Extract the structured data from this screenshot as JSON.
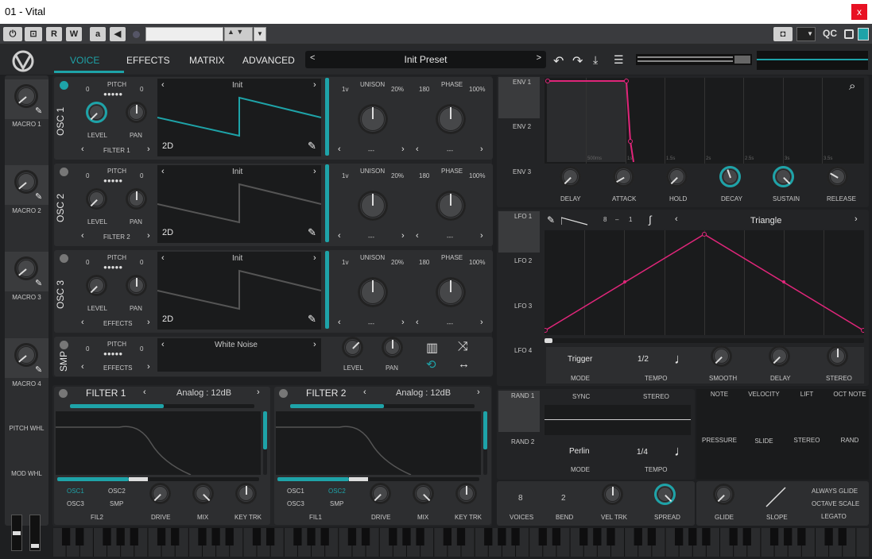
{
  "window": {
    "title": "01 - Vital",
    "close": "x"
  },
  "host": {
    "buttons": [
      "⏻",
      "⊡",
      "R",
      "W",
      "a",
      "◀"
    ],
    "qc": "QC",
    "colors": {
      "accent": "#1ea3a8",
      "pink": "#e0267a"
    }
  },
  "tabs": [
    "VOICE",
    "EFFECTS",
    "MATRIX",
    "ADVANCED"
  ],
  "preset": {
    "name": "Init Preset",
    "prev": "<",
    "next": ">"
  },
  "macros": [
    "MACRO 1",
    "MACRO 2",
    "MACRO 3",
    "MACRO 4"
  ],
  "wheels": {
    "pitch": "PITCH WHL",
    "mod": "MOD WHL"
  },
  "oscs": [
    {
      "name": "OSC 1",
      "pitch_left": "0",
      "pitch_label": "PITCH",
      "pitch_right": "0",
      "level": "LEVEL",
      "pan": "PAN",
      "dest": "FILTER 1",
      "wave": "Init",
      "mode": "2D",
      "unison_left": "1v",
      "unison": "UNISON",
      "unison_pct": "20%",
      "phase_left": "180",
      "phase": "PHASE",
      "phase_pct": "100%",
      "sel1": "---",
      "sel2": "---"
    },
    {
      "name": "OSC 2",
      "pitch_left": "0",
      "pitch_label": "PITCH",
      "pitch_right": "0",
      "level": "LEVEL",
      "pan": "PAN",
      "dest": "FILTER 2",
      "wave": "Init",
      "mode": "2D",
      "unison_left": "1v",
      "unison": "UNISON",
      "unison_pct": "20%",
      "phase_left": "180",
      "phase": "PHASE",
      "phase_pct": "100%",
      "sel1": "---",
      "sel2": "---"
    },
    {
      "name": "OSC 3",
      "pitch_left": "0",
      "pitch_label": "PITCH",
      "pitch_right": "0",
      "level": "LEVEL",
      "pan": "PAN",
      "dest": "EFFECTS",
      "wave": "Init",
      "mode": "2D",
      "unison_left": "1v",
      "unison": "UNISON",
      "unison_pct": "20%",
      "phase_left": "180",
      "phase": "PHASE",
      "phase_pct": "100%",
      "sel1": "---",
      "sel2": "---"
    }
  ],
  "smp": {
    "name": "SMP",
    "pitch_left": "0",
    "pitch_label": "PITCH",
    "pitch_right": "0",
    "dest": "EFFECTS",
    "sample": "White Noise",
    "level": "LEVEL",
    "pan": "PAN"
  },
  "filters": [
    {
      "name": "FILTER 1",
      "type": "Analog : 12dB",
      "src": [
        "OSC1",
        "OSC2",
        "OSC3",
        "SMP"
      ],
      "route": "FIL2",
      "drive": "DRIVE",
      "mix": "MIX",
      "keytrk": "KEY TRK"
    },
    {
      "name": "FILTER 2",
      "type": "Analog : 12dB",
      "src": [
        "OSC1",
        "OSC2",
        "OSC3",
        "SMP"
      ],
      "route": "FIL1",
      "drive": "DRIVE",
      "mix": "MIX",
      "keytrk": "KEY TRK"
    }
  ],
  "env": {
    "tabs": [
      "ENV 1",
      "ENV 2",
      "ENV 3"
    ],
    "times": [
      "500ms",
      "1s",
      "1.5s",
      "2s",
      "2.5s",
      "3s",
      "3.5s"
    ],
    "knobs": [
      "DELAY",
      "ATTACK",
      "HOLD",
      "DECAY",
      "SUSTAIN",
      "RELEASE"
    ]
  },
  "lfo": {
    "tabs": [
      "LFO 1",
      "LFO 2",
      "LFO 3",
      "LFO 4"
    ],
    "frac_top": "8",
    "frac_dash": "–",
    "frac_bot": "1",
    "shape": "Triangle",
    "mode_value": "Trigger",
    "mode_label": "MODE",
    "tempo_value": "1/2",
    "tempo_label": "TEMPO",
    "knobs": [
      "SMOOTH",
      "DELAY",
      "STEREO"
    ]
  },
  "rand": {
    "tabs": [
      "RAND 1",
      "RAND 2"
    ],
    "sync": "SYNC",
    "stereo": "STEREO",
    "mode_value": "Perlin",
    "mode_label": "MODE",
    "tempo_value": "1/4",
    "tempo_label": "TEMPO"
  },
  "sources": [
    "NOTE",
    "VELOCITY",
    "LIFT",
    "OCT NOTE",
    "PRESSURE",
    "SLIDE",
    "STEREO",
    "RAND"
  ],
  "voice": {
    "voices_value": "8",
    "voices": "VOICES",
    "bend_value": "2",
    "bend": "BEND",
    "veltrk": "VEL TRK",
    "spread": "SPREAD"
  },
  "glide": {
    "glide": "GLIDE",
    "slope": "SLOPE",
    "opts": [
      "ALWAYS GLIDE",
      "OCTAVE SCALE",
      "LEGATO"
    ]
  }
}
